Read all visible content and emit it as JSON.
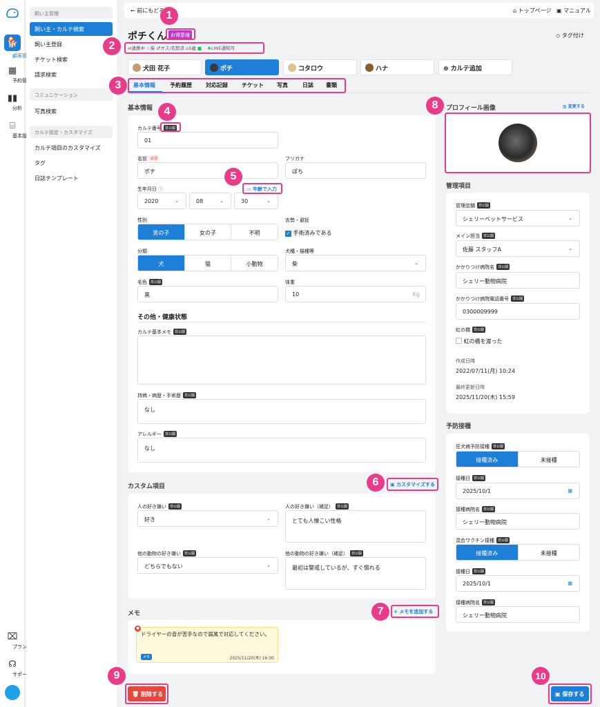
{
  "rail": {
    "items": [
      {
        "icon": "dog-icon",
        "label": "顧客管理"
      },
      {
        "icon": "calendar-icon",
        "label": "予約管理"
      },
      {
        "icon": "bar-chart-icon",
        "label": "分析"
      },
      {
        "icon": "store-icon",
        "label": "基本設定"
      },
      {
        "icon": "map-icon",
        "label": "プラン"
      },
      {
        "icon": "support-icon",
        "label": "サポート"
      }
    ]
  },
  "sidebar": {
    "sections": [
      "飼い主管理",
      "コミュニケーション",
      "カルテ設定・カスタマイズ"
    ],
    "items": [
      "飼い主・カルテ検索",
      "飼い主登録",
      "チケット検索",
      "請求検索",
      "写真検索",
      "カルテ項目のカスタマイズ",
      "タグ",
      "日誌テンプレート"
    ]
  },
  "topbar": {
    "back": "前にもどる",
    "top_page": "トップページ",
    "manual": "マニュアル"
  },
  "header": {
    "pet_name": "ポチくん",
    "vip_badge": "お得意様",
    "info": [
      "連携中",
      "柴",
      "オス/去勢済",
      "5歳",
      "LINE通知可"
    ],
    "tag_button": "タグ付け"
  },
  "pets": [
    {
      "name": "犬田 花子"
    },
    {
      "name": "ポチ"
    },
    {
      "name": "コタロウ"
    },
    {
      "name": "ハナ"
    },
    {
      "name": "カルテ追加"
    }
  ],
  "tabs": [
    "基本情報",
    "予約履歴",
    "対応記録",
    "チケット",
    "写真",
    "日誌",
    "書類"
  ],
  "basic": {
    "title": "基本情報",
    "private": "非公開",
    "required": "必須",
    "karte_no_label": "カルテ番号",
    "karte_no": "01",
    "name_label": "名前",
    "name": "ポチ",
    "kana_label": "フリガナ",
    "kana": "ぽち",
    "birth_label": "生年月日",
    "birth_year": "2020",
    "birth_month": "08",
    "birth_day": "30",
    "age_input_button": "年齢で入力",
    "sex_label": "性別",
    "sex_options": [
      "男の子",
      "女の子",
      "不明"
    ],
    "neuter_label": "去勢・避妊",
    "neuter_text": "手術済みである",
    "class_label": "分類",
    "class_options": [
      "犬",
      "猫",
      "小動物"
    ],
    "breed_label": "犬種・猫種等",
    "breed": "柴",
    "color_label": "毛色",
    "color": "黒",
    "weight_label": "体重",
    "weight": "10",
    "weight_unit": "Kg",
    "other_title": "その他・健康状態",
    "memo_label": "カルテ基本メモ",
    "history_label": "持病・病歴・手術歴",
    "history": "なし",
    "allergy_label": "アレルギー",
    "allergy": "なし"
  },
  "custom": {
    "title": "カスタム項目",
    "customize_button": "カスタマイズする",
    "like_people_label": "人の好き嫌い",
    "like_people": "好き",
    "like_people_note_label": "人の好き嫌い（補足）",
    "like_people_note": "とても人懐こい性格",
    "like_animals_label": "他の動物の好き嫌い",
    "like_animals": "どちらでもない",
    "like_animals_note_label": "他の動物の好き嫌い（補足）",
    "like_animals_note": "最初は警戒しているが、すぐ慣れる"
  },
  "memo": {
    "title": "メモ",
    "add_button": "メモを追加する",
    "text": "ドライヤーの音が苦手なので弱風で対応してください。",
    "tag": "メモ",
    "date": "2025/11/20(木) 16:00"
  },
  "profile": {
    "title": "プロフィール画像",
    "change_button": "変更する"
  },
  "management": {
    "title": "管理項目",
    "store_label": "管理店舗",
    "store": "シェリーペットサービス",
    "staff_label": "メイン担当",
    "staff": "佐藤 スタッフA",
    "hospital_label": "かかりつけ病院名",
    "hospital": "シェリー動物病院",
    "hospital_tel_label": "かかりつけ病院電話番号",
    "hospital_tel": "0300009999",
    "rainbow_label": "虹の橋",
    "rainbow_text": "虹の橋を渡った",
    "created_label": "作成日時",
    "created": "2022/07/11(月) 10:24",
    "updated_label": "最終更新日時",
    "updated": "2025/11/20(木) 15:59"
  },
  "vaccine": {
    "title": "予防接種",
    "rabies_label": "狂犬病予防接種",
    "options": [
      "接種済み",
      "未接種"
    ],
    "date_label": "接種日",
    "rabies_date": "2025/10/1",
    "hospital_label": "接種病院名",
    "rabies_hospital": "シェリー動物病院",
    "combo_label": "混合ワクチン接種",
    "combo_date": "2025/10/1",
    "combo_hospital": "シェリー動物病院"
  },
  "footer": {
    "delete_button": "削除する",
    "save_button": "保存する"
  },
  "callouts": [
    "1",
    "2",
    "3",
    "4",
    "5",
    "6",
    "7",
    "8",
    "9",
    "10"
  ],
  "colors": {
    "accent": "#1e7fd8",
    "highlight": "#ea3b8b",
    "danger": "#e5483b"
  }
}
